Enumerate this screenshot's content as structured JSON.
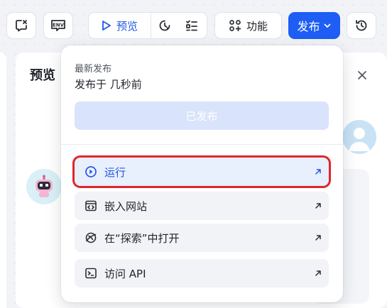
{
  "toolbar": {
    "env_label": "ENV",
    "preview_label": "预览",
    "functions_label": "功能",
    "publish_label": "发布"
  },
  "preview_panel": {
    "title": "预览"
  },
  "publish_menu": {
    "caption": "最新发布",
    "published_time": "发布于 几秒前",
    "published_button": "已发布",
    "items": [
      {
        "label": "运行",
        "icon": "play-circle-icon",
        "active": true
      },
      {
        "label": "嵌入网站",
        "icon": "embed-code-icon",
        "active": false
      },
      {
        "label": "在“探索”中打开",
        "icon": "explore-compass-icon",
        "active": false
      },
      {
        "label": "访问 API",
        "icon": "terminal-icon",
        "active": false
      }
    ]
  },
  "colors": {
    "accent": "#1e5ef4",
    "highlight_border": "#e0262a"
  }
}
